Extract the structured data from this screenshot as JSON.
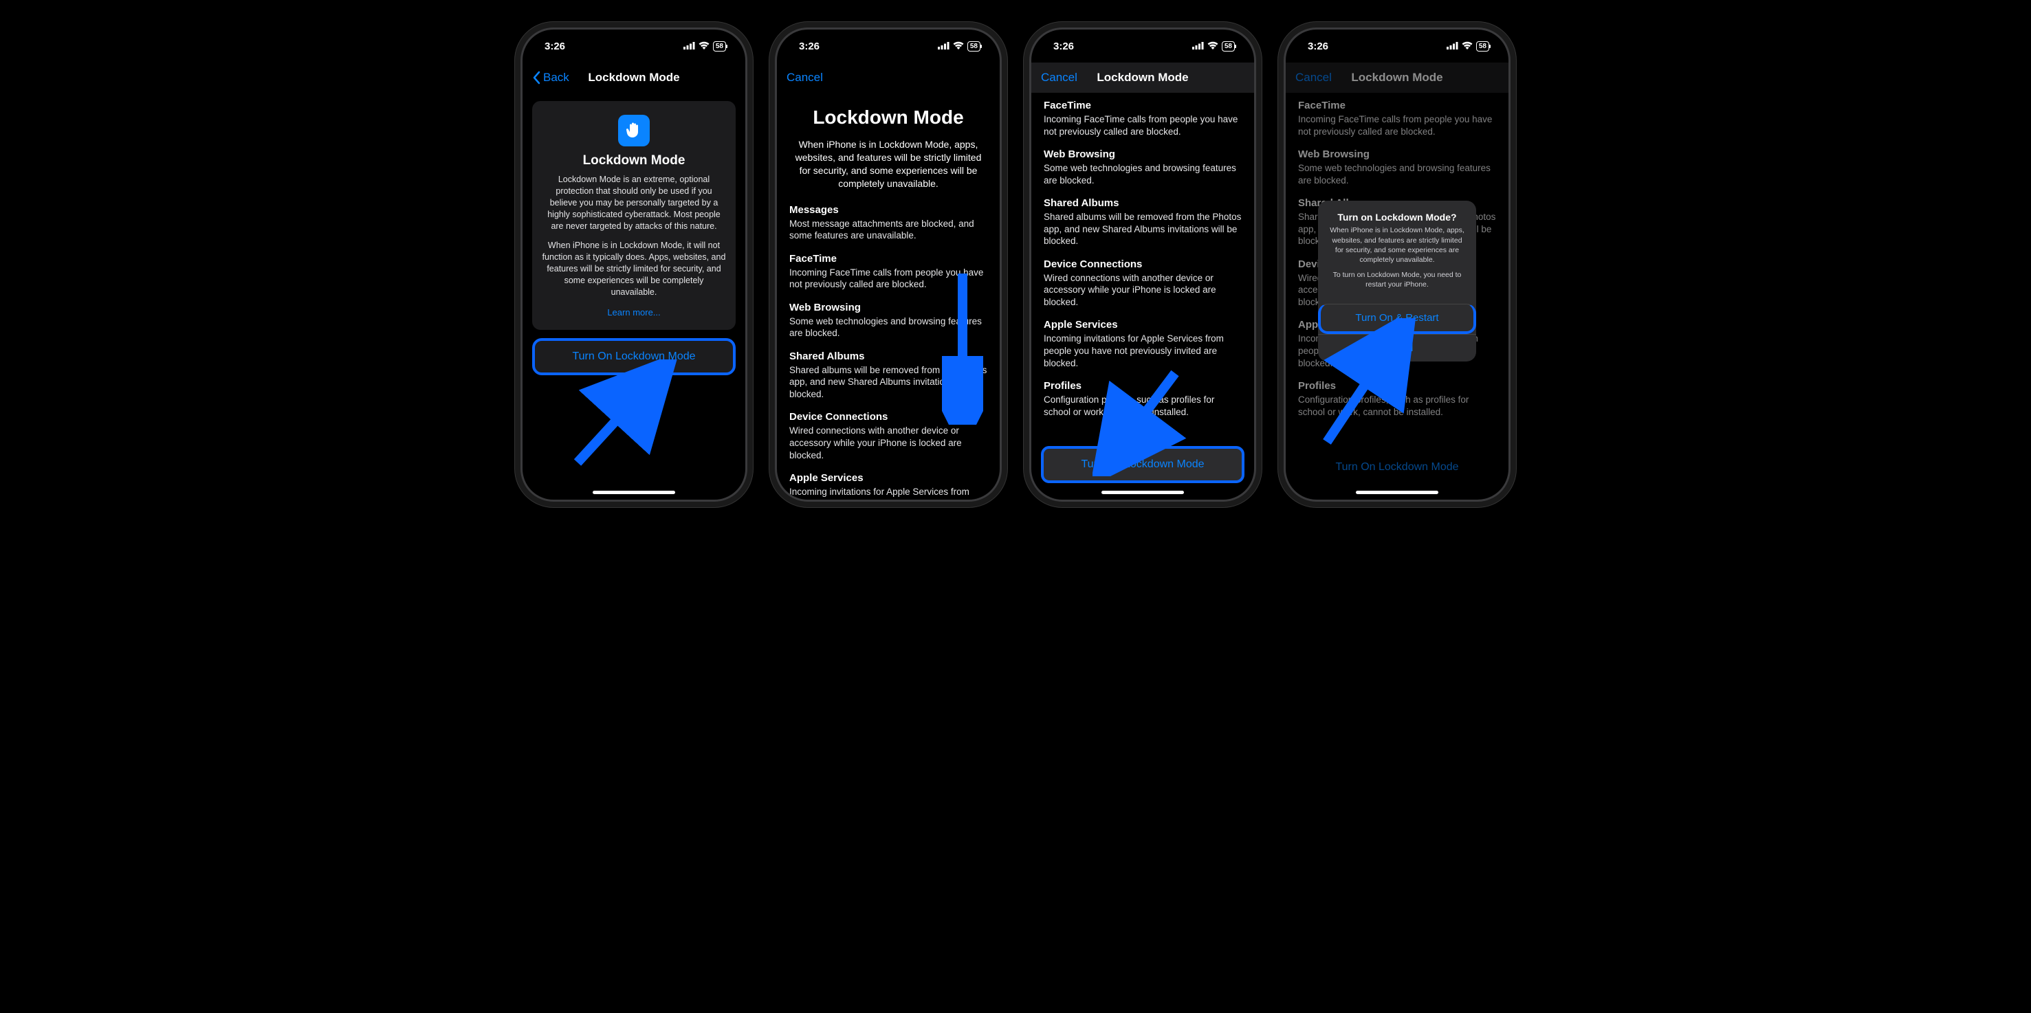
{
  "status": {
    "time": "3:26",
    "battery": "58"
  },
  "phone1": {
    "back": "Back",
    "title": "Lockdown Mode",
    "cardTitle": "Lockdown Mode",
    "p1": "Lockdown Mode is an extreme, optional protection that should only be used if you believe you may be personally targeted by a highly sophisticated cyberattack. Most people are never targeted by attacks of this nature.",
    "p2": "When iPhone is in Lockdown Mode, it will not function as it typically does. Apps, websites, and features will be strictly limited for security, and some experiences will be completely unavailable.",
    "learn": "Learn more...",
    "button": "Turn On Lockdown Mode"
  },
  "phone2": {
    "cancel": "Cancel",
    "title": "Lockdown Mode",
    "intro": "When iPhone is in Lockdown Mode, apps, websites, and features will be strictly limited for security, and some experiences will be completely unavailable.",
    "s1h": "Messages",
    "s1p": "Most message attachments are blocked, and some features are unavailable.",
    "s2h": "FaceTime",
    "s2p": "Incoming FaceTime calls from people you have not previously called are blocked.",
    "s3h": "Web Browsing",
    "s3p": "Some web technologies and browsing features are blocked.",
    "s4h": "Shared Albums",
    "s4p": "Shared albums will be removed from the Photos app, and new Shared Albums invitations will be blocked.",
    "s5h": "Device Connections",
    "s5p": "Wired connections with another device or accessory while your iPhone is locked are blocked.",
    "s6h": "Apple Services",
    "s6p": "Incoming invitations for Apple Services from"
  },
  "phone3": {
    "cancel": "Cancel",
    "title": "Lockdown Mode",
    "s1h": "FaceTime",
    "s1p": "Incoming FaceTime calls from people you have not previously called are blocked.",
    "s2h": "Web Browsing",
    "s2p": "Some web technologies and browsing features are blocked.",
    "s3h": "Shared Albums",
    "s3p": "Shared albums will be removed from the Photos app, and new Shared Albums invitations will be blocked.",
    "s4h": "Device Connections",
    "s4p": "Wired connections with another device or accessory while your iPhone is locked are blocked.",
    "s5h": "Apple Services",
    "s5p": "Incoming invitations for Apple Services from people you have not previously invited are blocked.",
    "s6h": "Profiles",
    "s6p": "Configuration profiles, such as profiles for school or work, cannot be installed.",
    "button": "Turn On Lockdown Mode"
  },
  "phone4": {
    "cancel": "Cancel",
    "title": "Lockdown Mode",
    "s1h": "FaceTime",
    "s1p": "Incoming FaceTime calls from people you have not previously called are blocked.",
    "s2h": "Web Browsing",
    "s2p": "Some web technologies and browsing features are blocked.",
    "s3h": "Shared Albums",
    "s3p": "Shared albums will be removed from the Photos app, and new Shared Albums invitations will be blocked.",
    "s4h": "Device Connections",
    "s4p": "Wired connections with another device or accessory while your iPhone is locked are blocked.",
    "s5h": "Apple Services",
    "s5p": "Incoming invitations for Apple Services from people you have not previously invited are blocked.",
    "s6h": "Profiles",
    "s6p": "Configuration profiles, such as profiles for school or work, cannot be installed.",
    "button": "Turn On Lockdown Mode",
    "alertTitle": "Turn on Lockdown Mode?",
    "alertP1": "When iPhone is in Lockdown Mode, apps, websites, and features are strictly limited for security, and some experiences are completely unavailable.",
    "alertP2": "To turn on Lockdown Mode, you need to restart your iPhone.",
    "alertPrimary": "Turn On & Restart",
    "alertCancel": "Cancel"
  }
}
